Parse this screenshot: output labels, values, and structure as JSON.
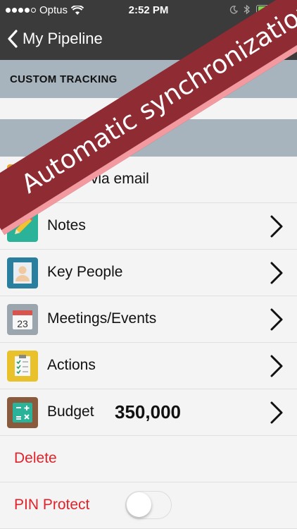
{
  "statusbar": {
    "carrier": "Optus",
    "time": "2:52 PM"
  },
  "navbar": {
    "back_label": "My Pipeline"
  },
  "sections": {
    "custom_tracking": "CUSTOM TRACKING"
  },
  "rows": {
    "share": "Share via email",
    "notes": "Notes",
    "people": "Key People",
    "meetings": "Meetings/Events",
    "calendar_day": "23",
    "actions": "Actions",
    "budget": "Budget",
    "budget_value": "350,000",
    "delete": "Delete",
    "pin": "PIN Protect"
  },
  "banner": {
    "text": "Automatic synchronization"
  },
  "colors": {
    "accent_red": "#e0232b",
    "bar": "#3b3b3b",
    "section": "#a7b4bd",
    "banner": "#8e2b33"
  }
}
